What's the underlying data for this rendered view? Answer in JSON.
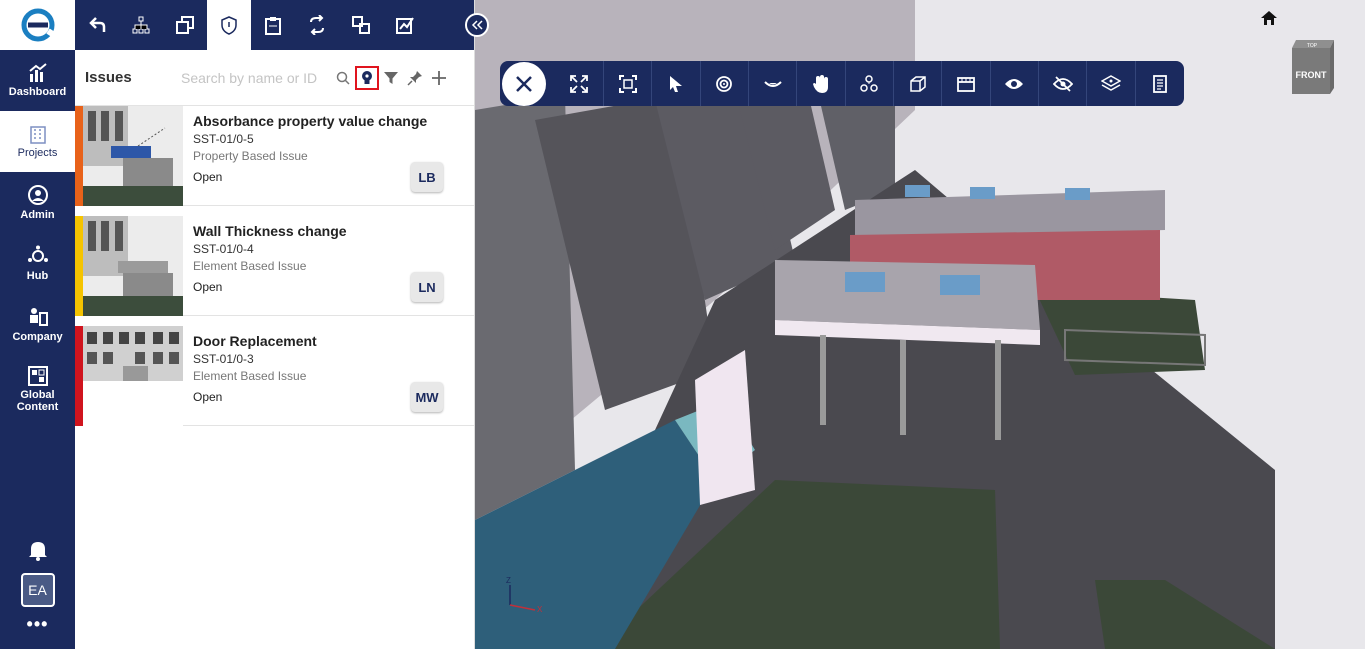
{
  "nav": {
    "items": [
      {
        "label": "Dashboard"
      },
      {
        "label": "Projects"
      },
      {
        "label": "Admin"
      },
      {
        "label": "Hub"
      },
      {
        "label": "Company"
      },
      {
        "label": "Global Content"
      }
    ],
    "avatar": "EA",
    "more": "•••"
  },
  "panel": {
    "title": "Issues",
    "search_placeholder": "Search by name or ID"
  },
  "issues": [
    {
      "title": "Absorbance property value change",
      "id": "SST-01/0-5",
      "type": "Property Based Issue",
      "status": "Open",
      "assignee": "LB",
      "color": "#e8621a"
    },
    {
      "title": "Wall Thickness change",
      "id": "SST-01/0-4",
      "type": "Element Based Issue",
      "status": "Open",
      "assignee": "LN",
      "color": "#f5c400"
    },
    {
      "title": "Door Replacement",
      "id": "SST-01/0-3",
      "type": "Element Based Issue",
      "status": "Open",
      "assignee": "MW",
      "color": "#d0141e"
    }
  ],
  "viewcube": {
    "top": "TOP",
    "front": "FRONT"
  },
  "axes": {
    "z": "Z",
    "x": "X"
  },
  "colors": {
    "nav": "#1b2a5e",
    "highlight": "#e0141e"
  }
}
